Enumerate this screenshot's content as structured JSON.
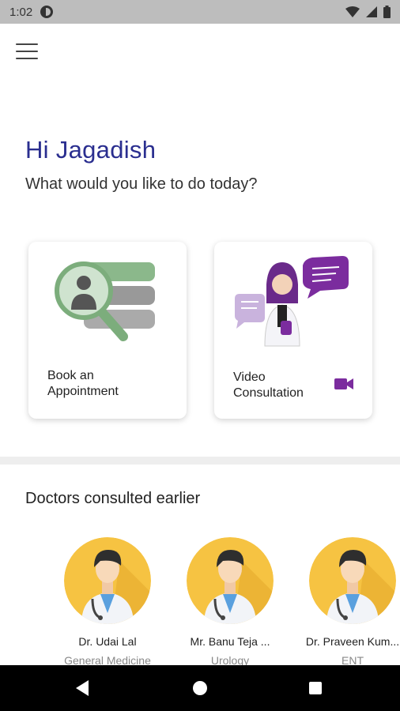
{
  "status_bar": {
    "time": "1:02",
    "icons": [
      "data-saver-icon",
      "wifi-icon",
      "signal-icon",
      "battery-icon"
    ]
  },
  "header": {
    "menu_icon": "hamburger-menu-icon"
  },
  "greeting": {
    "title": "Hi Jagadish",
    "subtitle": "What would you like to do today?"
  },
  "actions": [
    {
      "label": "Book an\nAppointment",
      "icon": "search-doctor-illustration"
    },
    {
      "label": "Video\nConsultation",
      "icon": "video-camera-icon"
    }
  ],
  "doctors_section": {
    "title": "Doctors consulted earlier",
    "doctors": [
      {
        "name": "Dr. Udai Lal",
        "specialty": "General Medicine"
      },
      {
        "name": "Mr. Banu Teja ...",
        "specialty": "Urology"
      },
      {
        "name": "Dr. Praveen Kum...",
        "specialty": "ENT"
      }
    ]
  },
  "nav_bar": {
    "icons": [
      "back-icon",
      "home-icon",
      "recents-icon"
    ]
  },
  "colors": {
    "accent": "#2a2e8f",
    "video_purple": "#7b2c9e",
    "avatar_yellow": "#f6c342",
    "illustration_green": "#7cad7c"
  }
}
